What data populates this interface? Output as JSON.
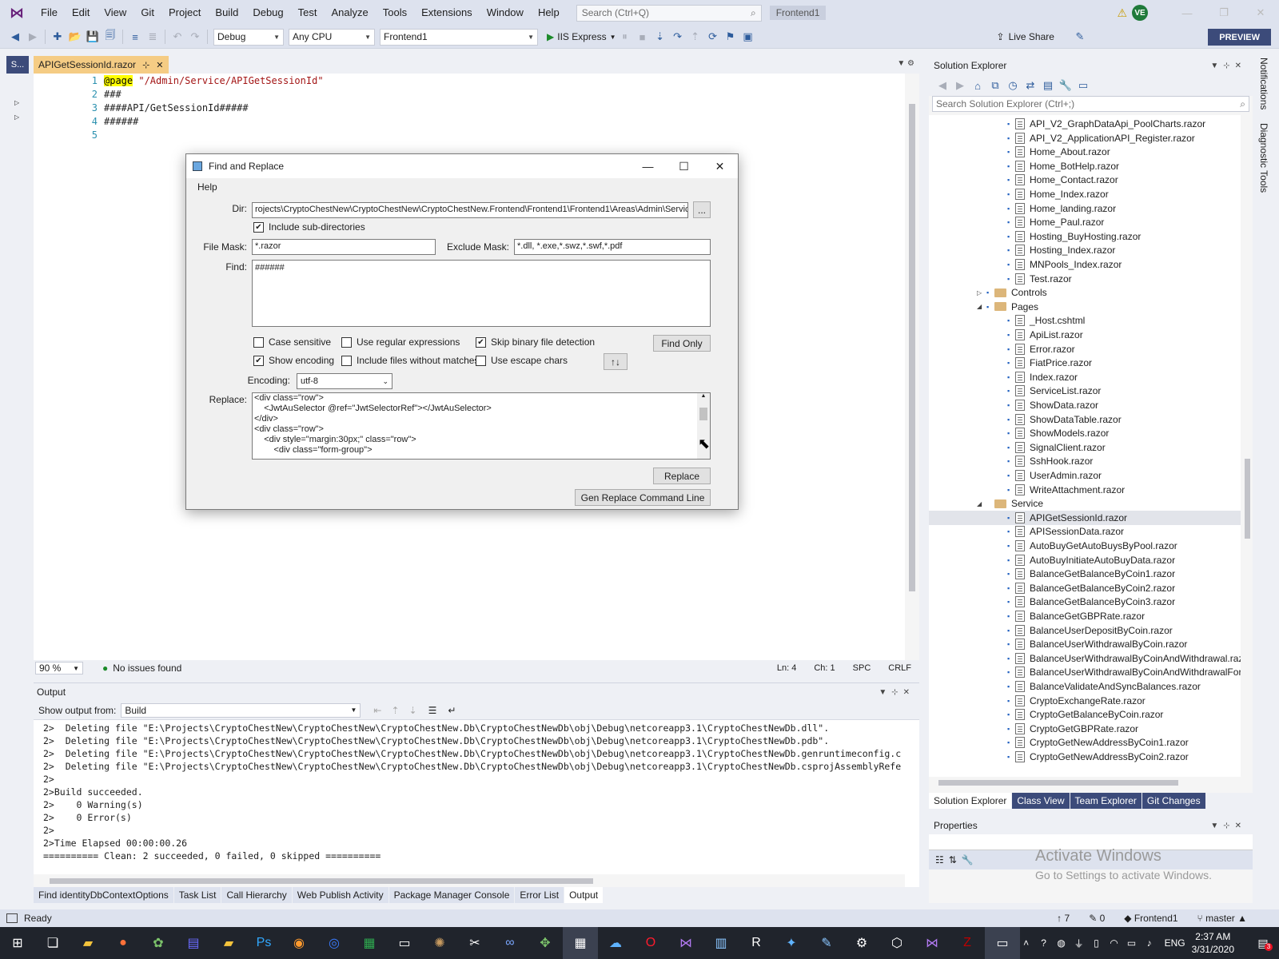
{
  "menu": {
    "items": [
      "File",
      "Edit",
      "View",
      "Git",
      "Project",
      "Build",
      "Debug",
      "Test",
      "Analyze",
      "Tools",
      "Extensions",
      "Window",
      "Help"
    ],
    "search_placeholder": "Search (Ctrl+Q)",
    "solution_name": "Frontend1",
    "user_initials": "VE"
  },
  "toolbar": {
    "configuration": "Debug",
    "platform": "Any CPU",
    "startup_project": "Frontend1",
    "run_label": "IIS Express",
    "live_share": "Live Share",
    "preview": "PREVIEW"
  },
  "left_strip": {
    "tab": "S..."
  },
  "editor": {
    "tab_title": "APIGetSessionId.razor",
    "lines": [
      {
        "no": "1",
        "directive": "@page",
        "text": " \"/Admin/Service/APIGetSessionId\""
      },
      {
        "no": "2",
        "directive": "",
        "text": "###"
      },
      {
        "no": "3",
        "directive": "",
        "text": "####API/GetSessionId#####"
      },
      {
        "no": "4",
        "directive": "",
        "text": "######"
      },
      {
        "no": "5",
        "directive": "",
        "text": ""
      }
    ],
    "zoom": "90 %",
    "issues": "No issues found",
    "ln": "Ln: 4",
    "ch": "Ch: 1",
    "spc": "SPC",
    "crlf": "CRLF"
  },
  "dialog": {
    "title": "Find and Replace",
    "menu_help": "Help",
    "dir_label": "Dir:",
    "dir_value": "rojects\\CryptoChestNew\\CryptoChestNew\\CryptoChestNew.Frontend\\Frontend1\\Frontend1\\Areas\\Admin\\Service",
    "browse": "...",
    "include_subdirs": "Include sub-directories",
    "file_mask_label": "File Mask:",
    "file_mask_value": "*.razor",
    "exclude_mask_label": "Exclude Mask:",
    "exclude_mask_value": "*.dll, *.exe,*.swz,*.swf,*.pdf",
    "find_label": "Find:",
    "find_value": "######",
    "case_sensitive": "Case sensitive",
    "use_regex": "Use regular expressions",
    "skip_binary": "Skip binary file detection",
    "show_encoding": "Show encoding",
    "include_without_matches": "Include files without matches",
    "use_escape": "Use escape chars",
    "find_only": "Find Only",
    "swap": "↑↓",
    "encoding_label": "Encoding:",
    "encoding_value": "utf-8",
    "replace_label": "Replace:",
    "replace_lines": [
      "<div class=\"row\">",
      "    <JwtAuSelector @ref=\"JwtSelectorRef\"></JwtAuSelector>",
      "</div>",
      "<div class=\"row\">",
      "    <div style=\"margin:30px;\" class=\"row\">",
      "        <div class=\"form-group\">"
    ],
    "replace_button": "Replace",
    "gen_button": "Gen Replace Command Line"
  },
  "output": {
    "title": "Output",
    "show_from_label": "Show output from:",
    "source": "Build",
    "lines": [
      "2>  Deleting file \"E:\\Projects\\CryptoChestNew\\CryptoChestNew\\CryptoChestNew.Db\\CryptoChestNewDb\\obj\\Debug\\netcoreapp3.1\\CryptoChestNewDb.dll\".",
      "2>  Deleting file \"E:\\Projects\\CryptoChestNew\\CryptoChestNew\\CryptoChestNew.Db\\CryptoChestNewDb\\obj\\Debug\\netcoreapp3.1\\CryptoChestNewDb.pdb\".",
      "2>  Deleting file \"E:\\Projects\\CryptoChestNew\\CryptoChestNew\\CryptoChestNew.Db\\CryptoChestNewDb\\obj\\Debug\\netcoreapp3.1\\CryptoChestNewDb.genruntimeconfig.c",
      "2>  Deleting file \"E:\\Projects\\CryptoChestNew\\CryptoChestNew\\CryptoChestNew.Db\\CryptoChestNewDb\\obj\\Debug\\netcoreapp3.1\\CryptoChestNewDb.csprojAssemblyRefe",
      "2>",
      "2>Build succeeded.",
      "2>    0 Warning(s)",
      "2>    0 Error(s)",
      "2>",
      "2>Time Elapsed 00:00:00.26",
      "========== Clean: 2 succeeded, 0 failed, 0 skipped =========="
    ]
  },
  "bottom_tabs": [
    {
      "label": "Find identityDbContextOptions",
      "active": false
    },
    {
      "label": "Task List",
      "active": false
    },
    {
      "label": "Call Hierarchy",
      "active": false
    },
    {
      "label": "Web Publish Activity",
      "active": false
    },
    {
      "label": "Package Manager Console",
      "active": false
    },
    {
      "label": "Error List",
      "active": false
    },
    {
      "label": "Output",
      "active": true
    }
  ],
  "solution_explorer": {
    "title": "Solution Explorer",
    "search_placeholder": "Search Solution Explorer (Ctrl+;)",
    "tree": [
      {
        "kind": "file",
        "indent": 1,
        "label": "API_V2_GraphDataApi_PoolCharts.razor"
      },
      {
        "kind": "file",
        "indent": 1,
        "label": "API_V2_ApplicationAPI_Register.razor"
      },
      {
        "kind": "file",
        "indent": 1,
        "label": "Home_About.razor"
      },
      {
        "kind": "file",
        "indent": 1,
        "label": "Home_BotHelp.razor"
      },
      {
        "kind": "file",
        "indent": 1,
        "label": "Home_Contact.razor"
      },
      {
        "kind": "file",
        "indent": 1,
        "label": "Home_Index.razor"
      },
      {
        "kind": "file",
        "indent": 1,
        "label": "Home_landing.razor"
      },
      {
        "kind": "file",
        "indent": 1,
        "label": "Home_Paul.razor"
      },
      {
        "kind": "file",
        "indent": 1,
        "label": "Hosting_BuyHosting.razor"
      },
      {
        "kind": "file",
        "indent": 1,
        "label": "Hosting_Index.razor"
      },
      {
        "kind": "file",
        "indent": 1,
        "label": "MNPools_Index.razor"
      },
      {
        "kind": "file",
        "indent": 1,
        "label": "Test.razor"
      },
      {
        "kind": "folder-collapsed",
        "indent": 0,
        "label": "Controls"
      },
      {
        "kind": "folder-open",
        "indent": 0,
        "label": "Pages"
      },
      {
        "kind": "file",
        "indent": 1,
        "label": "_Host.cshtml"
      },
      {
        "kind": "file",
        "indent": 1,
        "label": "ApiList.razor"
      },
      {
        "kind": "file",
        "indent": 1,
        "label": "Error.razor"
      },
      {
        "kind": "file",
        "indent": 1,
        "label": "FiatPrice.razor"
      },
      {
        "kind": "file",
        "indent": 1,
        "label": "Index.razor"
      },
      {
        "kind": "file",
        "indent": 1,
        "label": "ServiceList.razor"
      },
      {
        "kind": "file",
        "indent": 1,
        "label": "ShowData.razor"
      },
      {
        "kind": "file",
        "indent": 1,
        "label": "ShowDataTable.razor"
      },
      {
        "kind": "file",
        "indent": 1,
        "label": "ShowModels.razor"
      },
      {
        "kind": "file",
        "indent": 1,
        "label": "SignalClient.razor"
      },
      {
        "kind": "file",
        "indent": 1,
        "label": "SshHook.razor"
      },
      {
        "kind": "file",
        "indent": 1,
        "label": "UserAdmin.razor"
      },
      {
        "kind": "file",
        "indent": 1,
        "label": "WriteAttachment.razor"
      },
      {
        "kind": "folder-open-nolock",
        "indent": 0,
        "label": "Service"
      },
      {
        "kind": "file-selected",
        "indent": 1,
        "label": "APIGetSessionId.razor"
      },
      {
        "kind": "file",
        "indent": 1,
        "label": "APISessionData.razor"
      },
      {
        "kind": "file",
        "indent": 1,
        "label": "AutoBuyGetAutoBuysByPool.razor"
      },
      {
        "kind": "file",
        "indent": 1,
        "label": "AutoBuyInitiateAutoBuyData.razor"
      },
      {
        "kind": "file",
        "indent": 1,
        "label": "BalanceGetBalanceByCoin1.razor"
      },
      {
        "kind": "file",
        "indent": 1,
        "label": "BalanceGetBalanceByCoin2.razor"
      },
      {
        "kind": "file",
        "indent": 1,
        "label": "BalanceGetBalanceByCoin3.razor"
      },
      {
        "kind": "file",
        "indent": 1,
        "label": "BalanceGetGBPRate.razor"
      },
      {
        "kind": "file",
        "indent": 1,
        "label": "BalanceUserDepositByCoin.razor"
      },
      {
        "kind": "file",
        "indent": 1,
        "label": "BalanceUserWithdrawalByCoin.razor"
      },
      {
        "kind": "file",
        "indent": 1,
        "label": "BalanceUserWithdrawalByCoinAndWithdrawal.razo"
      },
      {
        "kind": "file",
        "indent": 1,
        "label": "BalanceUserWithdrawalByCoinAndWithdrawalFor/"
      },
      {
        "kind": "file",
        "indent": 1,
        "label": "BalanceValidateAndSyncBalances.razor"
      },
      {
        "kind": "file",
        "indent": 1,
        "label": "CryptoExchangeRate.razor"
      },
      {
        "kind": "file",
        "indent": 1,
        "label": "CryptoGetBalanceByCoin.razor"
      },
      {
        "kind": "file",
        "indent": 1,
        "label": "CryptoGetGBPRate.razor"
      },
      {
        "kind": "file",
        "indent": 1,
        "label": "CryptoGetNewAddressByCoin1.razor"
      },
      {
        "kind": "file",
        "indent": 1,
        "label": "CryptoGetNewAddressByCoin2.razor"
      }
    ],
    "tabs": [
      {
        "label": "Solution Explorer",
        "active": true
      },
      {
        "label": "Class View",
        "active": false
      },
      {
        "label": "Team Explorer",
        "active": false
      },
      {
        "label": "Git Changes",
        "active": false
      }
    ]
  },
  "properties": {
    "title": "Properties"
  },
  "watermark": {
    "line1": "Activate Windows",
    "line2": "Go to Settings to activate Windows."
  },
  "right_strip": {
    "tab1": "Notifications",
    "tab2": "Diagnostic Tools"
  },
  "status": {
    "ready": "Ready",
    "up_count": "7",
    "pencil_count": "0",
    "repo": "Frontend1",
    "branch": "master"
  },
  "taskbar": {
    "lang": "ENG",
    "time": "2:37 AM",
    "date": "3/31/2020",
    "notification_count": "3"
  }
}
